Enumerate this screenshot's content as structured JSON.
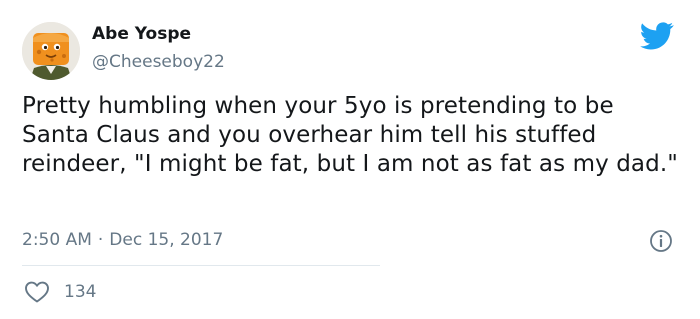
{
  "author": {
    "display_name": "Abe Yospe",
    "handle": "@Cheeseboy22",
    "avatar_icon": "cheese-mascot-avatar"
  },
  "brand_icon": "twitter-bird-icon",
  "tweet": {
    "text": "Pretty humbling when your 5yo is pretending to be Santa Claus and you overhear him tell his stuffed reindeer, \"I might be fat, but I am not as fat as my dad.\"",
    "time": "2:50 AM",
    "separator": "·",
    "date": "Dec 15, 2017"
  },
  "engagement": {
    "likes": "134",
    "like_icon": "heart-outline-icon",
    "info_icon": "info-circle-icon"
  },
  "colors": {
    "brand": "#1da1f2",
    "text": "#14171a",
    "secondary": "#657786",
    "divider": "#e1e8ed"
  }
}
